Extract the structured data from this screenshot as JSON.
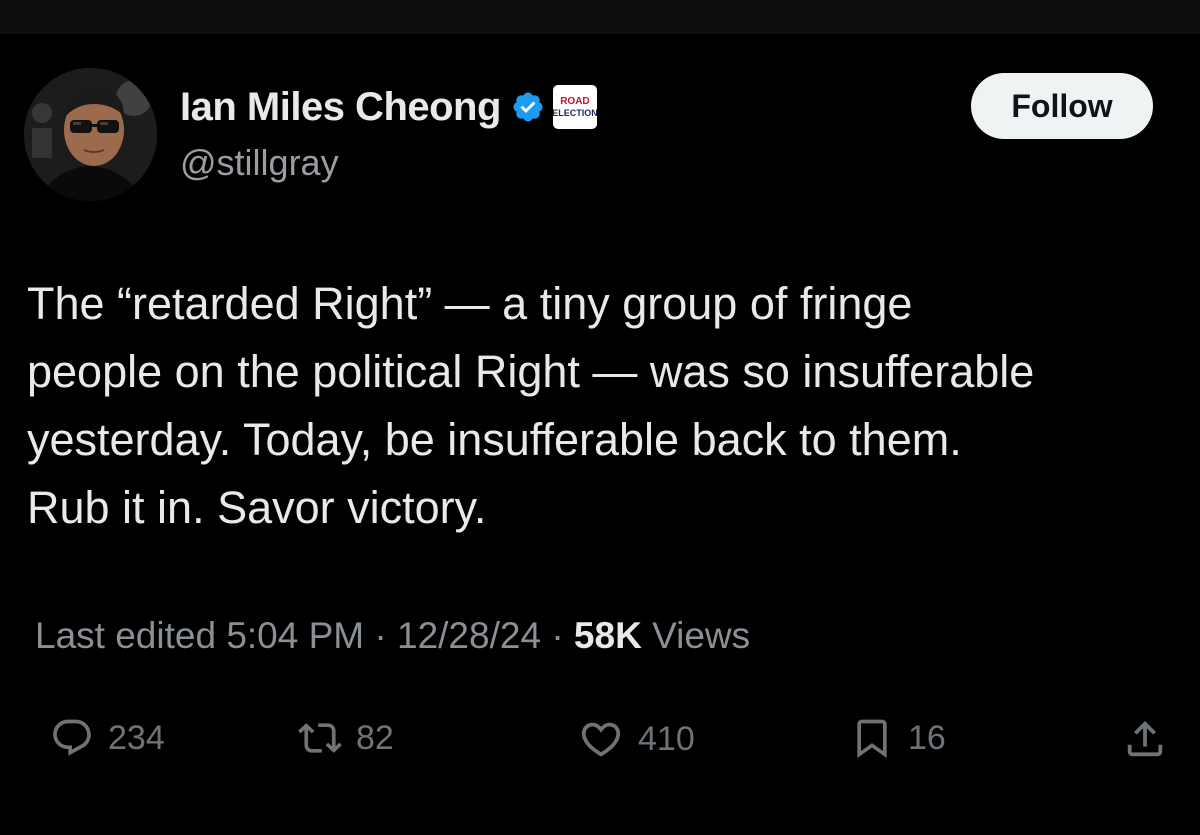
{
  "author": {
    "display_name": "Ian Miles Cheong",
    "handle": "@stillgray",
    "affiliation_badge": {
      "line1": "ROAD",
      "line2": "ELECTION"
    }
  },
  "follow_button_label": "Follow",
  "tweet": {
    "text": "The “retarded Right” — a tiny group of fringe\npeople on the political Right — was so insufferable\nyesterday. Today, be insufferable back to them.\nRub it in. Savor victory."
  },
  "meta": {
    "edited_prefix": "Last edited",
    "time": "5:04 PM",
    "separator": "·",
    "date": "12/28/24",
    "views_count": "58K",
    "views_label": "Views"
  },
  "actions": {
    "replies": "234",
    "reposts": "82",
    "likes": "410",
    "bookmarks": "16"
  },
  "icons": {
    "verified": "verified-badge-icon",
    "reply": "reply-icon",
    "repost": "repost-icon",
    "like": "heart-icon",
    "bookmark": "bookmark-icon",
    "share": "share-icon"
  },
  "colors": {
    "background": "#000000",
    "text_primary": "#e7e9ea",
    "text_secondary": "#8b9096",
    "verified_blue": "#1d9bf0",
    "follow_button_bg": "#eff3f4"
  }
}
